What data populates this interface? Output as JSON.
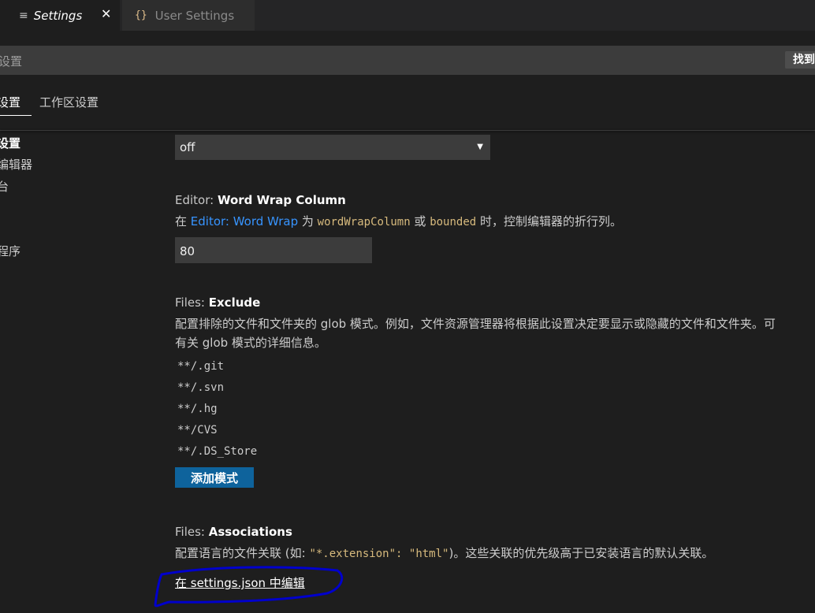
{
  "tabs": [
    {
      "label": "Settings",
      "icon": "list-icon"
    },
    {
      "label": "User Settings",
      "icon": "braces-icon"
    }
  ],
  "search": {
    "placeholder": "设置",
    "find_button": "找到"
  },
  "scopes": [
    {
      "label": "设置"
    },
    {
      "label": "工作区设置"
    }
  ],
  "toc": [
    "设置",
    "编辑器",
    "台",
    "程序"
  ],
  "settings": {
    "wrap_select": {
      "value": "off"
    },
    "word_wrap_column": {
      "category": "Editor: ",
      "key": "Word Wrap Column",
      "desc_pre": "在 ",
      "desc_link": "Editor: Word Wrap",
      "desc_mid1": " 为 ",
      "code1": "wordWrapColumn",
      "desc_mid2": " 或 ",
      "code2": "bounded",
      "desc_post": " 时，控制编辑器的折行列。",
      "value": "80"
    },
    "files_exclude": {
      "category": "Files: ",
      "key": "Exclude",
      "desc_line1": "配置排除的文件和文件夹的 glob 模式。例如，文件资源管理器将根据此设置决定要显示或隐藏的文件和文件夹。可",
      "desc_line2": "有关 glob 模式的详细信息。",
      "patterns": [
        "**/.git",
        "**/.svn",
        "**/.hg",
        "**/CVS",
        "**/.DS_Store"
      ],
      "add_button": "添加模式"
    },
    "files_associations": {
      "category": "Files: ",
      "key": "Associations",
      "desc_pre": "配置语言的文件关联 (如: ",
      "code": "\"*.extension\": \"html\"",
      "desc_post": ")。这些关联的优先级高于已安装语言的默认关联。",
      "edit_link": "在 settings.json 中编辑"
    }
  },
  "colors": {
    "accent_link": "#3794ff",
    "button": "#0e639c",
    "annotation": "#0000cc"
  }
}
